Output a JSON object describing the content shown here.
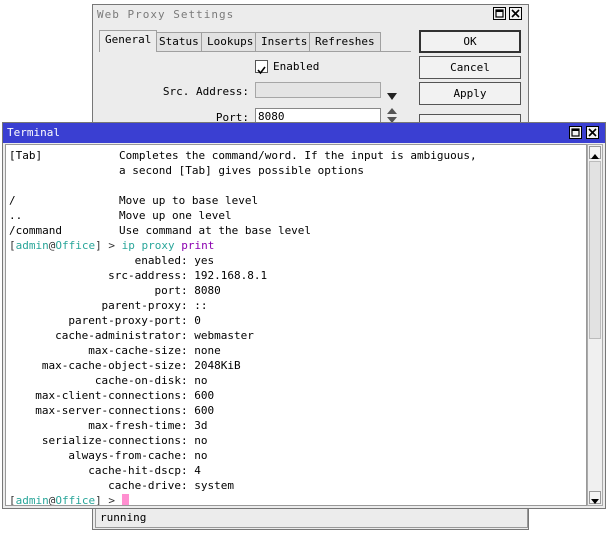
{
  "proxy_window": {
    "title": "Web Proxy Settings",
    "tabs": [
      "General",
      "Status",
      "Lookups",
      "Inserts",
      "Refreshes"
    ],
    "enabled_label": "Enabled",
    "enabled_checked": true,
    "src_address_label": "Src. Address:",
    "src_address_value": "",
    "port_label": "Port:",
    "port_value": "8080",
    "buttons": {
      "ok": "OK",
      "cancel": "Cancel",
      "apply": "Apply"
    },
    "status": "running"
  },
  "terminal": {
    "title": "Terminal",
    "help": [
      {
        "key": "[Tab]",
        "desc": "Completes the command/word. If the input is ambiguous,"
      },
      {
        "key": "",
        "desc": "a second [Tab] gives possible options"
      },
      {
        "key": "",
        "desc": ""
      },
      {
        "key": "/",
        "desc": "Move up to base level"
      },
      {
        "key": "..",
        "desc": "Move up one level"
      },
      {
        "key": "/command",
        "desc": "Use command at the base level"
      }
    ],
    "prompt": {
      "user": "admin",
      "host": "Office",
      "cmd_path": "ip proxy",
      "cmd": "print"
    },
    "output": [
      {
        "key": "enabled",
        "value": "yes"
      },
      {
        "key": "src-address",
        "value": "192.168.8.1"
      },
      {
        "key": "port",
        "value": "8080"
      },
      {
        "key": "parent-proxy",
        "value": "::"
      },
      {
        "key": "parent-proxy-port",
        "value": "0"
      },
      {
        "key": "cache-administrator",
        "value": "webmaster"
      },
      {
        "key": "max-cache-size",
        "value": "none"
      },
      {
        "key": "max-cache-object-size",
        "value": "2048KiB"
      },
      {
        "key": "cache-on-disk",
        "value": "no"
      },
      {
        "key": "max-client-connections",
        "value": "600"
      },
      {
        "key": "max-server-connections",
        "value": "600"
      },
      {
        "key": "max-fresh-time",
        "value": "3d"
      },
      {
        "key": "serialize-connections",
        "value": "no"
      },
      {
        "key": "always-from-cache",
        "value": "no"
      },
      {
        "key": "cache-hit-dscp",
        "value": "4"
      },
      {
        "key": "cache-drive",
        "value": "system"
      }
    ]
  }
}
